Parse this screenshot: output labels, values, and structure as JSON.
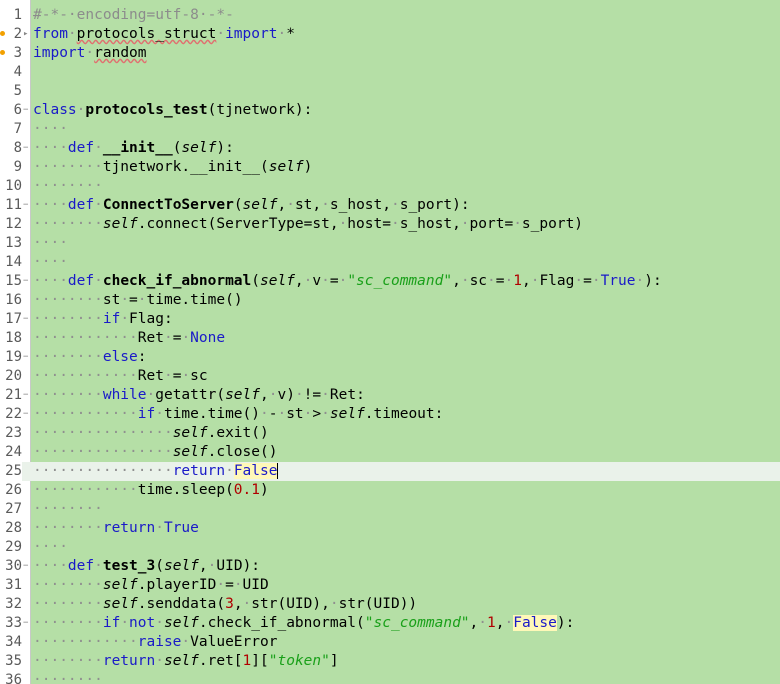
{
  "editor": {
    "language": "python",
    "current_line": 25,
    "colors": {
      "background": "#b5dfa6",
      "current_line": "#eaf2ea",
      "keyword": "#1a1ac8",
      "string": "#1aa01a",
      "number": "#b00000",
      "comment": "#8c8c8c",
      "whitespace_marker": "#8f8f8f"
    },
    "lines": [
      {
        "n": "1",
        "tokens": [
          [
            "cm",
            "#-*-"
          ],
          [
            "cm",
            "·"
          ],
          [
            "cm",
            "encoding=utf-8"
          ],
          [
            "cm",
            "·"
          ],
          [
            "cm",
            "-*-"
          ]
        ]
      },
      {
        "n": "2",
        "mark": true,
        "fold": "▸",
        "tokens": [
          [
            "kw",
            "from"
          ],
          [
            "ws",
            "·"
          ],
          [
            "sq",
            "protocols_struct"
          ],
          [
            "ws",
            "·"
          ],
          [
            "kw",
            "import"
          ],
          [
            "ws",
            "·"
          ],
          [
            "t",
            "*"
          ]
        ]
      },
      {
        "n": "3",
        "mark": true,
        "tokens": [
          [
            "kw",
            "import"
          ],
          [
            "ws",
            "·"
          ],
          [
            "sq",
            "random"
          ]
        ]
      },
      {
        "n": "4",
        "tokens": []
      },
      {
        "n": "5",
        "tokens": []
      },
      {
        "n": "6",
        "fold": "−",
        "tokens": [
          [
            "kw",
            "class"
          ],
          [
            "ws",
            "·"
          ],
          [
            "bd",
            "protocols_test"
          ],
          [
            "t",
            "(tjnetwork):"
          ]
        ]
      },
      {
        "n": "7",
        "tokens": [
          [
            "ws",
            "····"
          ]
        ]
      },
      {
        "n": "8",
        "fold": "−",
        "tokens": [
          [
            "ws",
            "····"
          ],
          [
            "kw",
            "def"
          ],
          [
            "ws",
            "·"
          ],
          [
            "bd",
            "__init__"
          ],
          [
            "t",
            "("
          ],
          [
            "sf",
            "self"
          ],
          [
            "t",
            "):"
          ]
        ]
      },
      {
        "n": "9",
        "tokens": [
          [
            "ws",
            "········"
          ],
          [
            "t",
            "tjnetwork.__init__("
          ],
          [
            "sf",
            "self"
          ],
          [
            "t",
            ")"
          ]
        ]
      },
      {
        "n": "10",
        "tokens": [
          [
            "ws",
            "········"
          ]
        ]
      },
      {
        "n": "11",
        "fold": "−",
        "tokens": [
          [
            "ws",
            "····"
          ],
          [
            "kw",
            "def"
          ],
          [
            "ws",
            "·"
          ],
          [
            "bd",
            "ConnectToServer"
          ],
          [
            "t",
            "("
          ],
          [
            "sf",
            "self"
          ],
          [
            "t",
            ","
          ],
          [
            "ws",
            "·"
          ],
          [
            "t",
            "st,"
          ],
          [
            "ws",
            "·"
          ],
          [
            "t",
            "s_host,"
          ],
          [
            "ws",
            "·"
          ],
          [
            "t",
            "s_port):"
          ]
        ]
      },
      {
        "n": "12",
        "tokens": [
          [
            "ws",
            "········"
          ],
          [
            "sf",
            "self"
          ],
          [
            "t",
            ".connect(ServerType=st,"
          ],
          [
            "ws",
            "·"
          ],
          [
            "t",
            "host="
          ],
          [
            "ws",
            "·"
          ],
          [
            "t",
            "s_host,"
          ],
          [
            "ws",
            "·"
          ],
          [
            "t",
            "port="
          ],
          [
            "ws",
            "·"
          ],
          [
            "t",
            "s_port)"
          ]
        ]
      },
      {
        "n": "13",
        "tokens": [
          [
            "ws",
            "····"
          ]
        ]
      },
      {
        "n": "14",
        "tokens": [
          [
            "ws",
            "····"
          ]
        ]
      },
      {
        "n": "15",
        "fold": "−",
        "tokens": [
          [
            "ws",
            "····"
          ],
          [
            "kw",
            "def"
          ],
          [
            "ws",
            "·"
          ],
          [
            "bd",
            "check_if_abnormal"
          ],
          [
            "t",
            "("
          ],
          [
            "sf",
            "self"
          ],
          [
            "t",
            ","
          ],
          [
            "ws",
            "·"
          ],
          [
            "t",
            "v"
          ],
          [
            "ws",
            "·"
          ],
          [
            "t",
            "="
          ],
          [
            "ws",
            "·"
          ],
          [
            "st",
            "\"sc_command\""
          ],
          [
            "t",
            ","
          ],
          [
            "ws",
            "·"
          ],
          [
            "t",
            "sc"
          ],
          [
            "ws",
            "·"
          ],
          [
            "t",
            "="
          ],
          [
            "ws",
            "·"
          ],
          [
            "nm",
            "1"
          ],
          [
            "t",
            ","
          ],
          [
            "ws",
            "·"
          ],
          [
            "t",
            "Flag"
          ],
          [
            "ws",
            "·"
          ],
          [
            "t",
            "="
          ],
          [
            "ws",
            "·"
          ],
          [
            "bi",
            "True"
          ],
          [
            "ws",
            "·"
          ],
          [
            "t",
            "):"
          ]
        ]
      },
      {
        "n": "16",
        "tokens": [
          [
            "ws",
            "········"
          ],
          [
            "t",
            "st"
          ],
          [
            "ws",
            "·"
          ],
          [
            "t",
            "="
          ],
          [
            "ws",
            "·"
          ],
          [
            "t",
            "time.time()"
          ]
        ]
      },
      {
        "n": "17",
        "fold": "−",
        "tokens": [
          [
            "ws",
            "········"
          ],
          [
            "kw",
            "if"
          ],
          [
            "ws",
            "·"
          ],
          [
            "t",
            "Flag:"
          ]
        ]
      },
      {
        "n": "18",
        "tokens": [
          [
            "ws",
            "············"
          ],
          [
            "t",
            "Ret"
          ],
          [
            "ws",
            "·"
          ],
          [
            "t",
            "="
          ],
          [
            "ws",
            "·"
          ],
          [
            "bi",
            "None"
          ]
        ]
      },
      {
        "n": "19",
        "fold": "−",
        "tokens": [
          [
            "ws",
            "········"
          ],
          [
            "kw",
            "else"
          ],
          [
            "t",
            ":"
          ]
        ]
      },
      {
        "n": "20",
        "tokens": [
          [
            "ws",
            "············"
          ],
          [
            "t",
            "Ret"
          ],
          [
            "ws",
            "·"
          ],
          [
            "t",
            "="
          ],
          [
            "ws",
            "·"
          ],
          [
            "t",
            "sc"
          ]
        ]
      },
      {
        "n": "21",
        "fold": "−",
        "tokens": [
          [
            "ws",
            "········"
          ],
          [
            "kw",
            "while"
          ],
          [
            "ws",
            "·"
          ],
          [
            "t",
            "getattr("
          ],
          [
            "sf",
            "self"
          ],
          [
            "t",
            ","
          ],
          [
            "ws",
            "·"
          ],
          [
            "t",
            "v)"
          ],
          [
            "ws",
            "·"
          ],
          [
            "t",
            "!="
          ],
          [
            "ws",
            "·"
          ],
          [
            "t",
            "Ret:"
          ]
        ]
      },
      {
        "n": "22",
        "fold": "−",
        "tokens": [
          [
            "ws",
            "············"
          ],
          [
            "kw",
            "if"
          ],
          [
            "ws",
            "·"
          ],
          [
            "t",
            "time.time()"
          ],
          [
            "ws",
            "·"
          ],
          [
            "t",
            "-"
          ],
          [
            "ws",
            "·"
          ],
          [
            "t",
            "st"
          ],
          [
            "ws",
            "·"
          ],
          [
            "t",
            ">"
          ],
          [
            "ws",
            "·"
          ],
          [
            "sf",
            "self"
          ],
          [
            "t",
            ".timeout:"
          ]
        ]
      },
      {
        "n": "23",
        "tokens": [
          [
            "ws",
            "················"
          ],
          [
            "sf",
            "self"
          ],
          [
            "t",
            ".exit()"
          ]
        ]
      },
      {
        "n": "24",
        "tokens": [
          [
            "ws",
            "················"
          ],
          [
            "sf",
            "self"
          ],
          [
            "t",
            ".close()"
          ]
        ]
      },
      {
        "n": "25",
        "current": true,
        "tokens": [
          [
            "ws",
            "················"
          ],
          [
            "kw",
            "return"
          ],
          [
            "ws",
            "·"
          ],
          [
            "bih",
            "False"
          ]
        ]
      },
      {
        "n": "26",
        "tokens": [
          [
            "ws",
            "············"
          ],
          [
            "t",
            "time.sleep("
          ],
          [
            "nm",
            "0.1"
          ],
          [
            "t",
            ")"
          ]
        ]
      },
      {
        "n": "27",
        "tokens": [
          [
            "ws",
            "········"
          ]
        ]
      },
      {
        "n": "28",
        "tokens": [
          [
            "ws",
            "········"
          ],
          [
            "kw",
            "return"
          ],
          [
            "ws",
            "·"
          ],
          [
            "bi",
            "True"
          ]
        ]
      },
      {
        "n": "29",
        "tokens": [
          [
            "ws",
            "····"
          ]
        ]
      },
      {
        "n": "30",
        "fold": "−",
        "tokens": [
          [
            "ws",
            "····"
          ],
          [
            "kw",
            "def"
          ],
          [
            "ws",
            "·"
          ],
          [
            "bd",
            "test_3"
          ],
          [
            "t",
            "("
          ],
          [
            "sf",
            "self"
          ],
          [
            "t",
            ","
          ],
          [
            "ws",
            "·"
          ],
          [
            "t",
            "UID):"
          ]
        ]
      },
      {
        "n": "31",
        "tokens": [
          [
            "ws",
            "········"
          ],
          [
            "sf",
            "self"
          ],
          [
            "t",
            ".playerID"
          ],
          [
            "ws",
            "·"
          ],
          [
            "t",
            "="
          ],
          [
            "ws",
            "·"
          ],
          [
            "t",
            "UID"
          ]
        ]
      },
      {
        "n": "32",
        "tokens": [
          [
            "ws",
            "········"
          ],
          [
            "sf",
            "self"
          ],
          [
            "t",
            ".senddata("
          ],
          [
            "nm",
            "3"
          ],
          [
            "t",
            ","
          ],
          [
            "ws",
            "·"
          ],
          [
            "t",
            "str(UID),"
          ],
          [
            "ws",
            "·"
          ],
          [
            "t",
            "str(UID))"
          ]
        ]
      },
      {
        "n": "33",
        "fold": "−",
        "tokens": [
          [
            "ws",
            "········"
          ],
          [
            "kw",
            "if"
          ],
          [
            "ws",
            "·"
          ],
          [
            "kw",
            "not"
          ],
          [
            "ws",
            "·"
          ],
          [
            "sf",
            "self"
          ],
          [
            "t",
            ".check_if_abnormal("
          ],
          [
            "st",
            "\"sc_command\""
          ],
          [
            "t",
            ","
          ],
          [
            "ws",
            "·"
          ],
          [
            "nm",
            "1"
          ],
          [
            "t",
            ","
          ],
          [
            "ws",
            "·"
          ],
          [
            "bih",
            "False"
          ],
          [
            "t",
            "):"
          ]
        ]
      },
      {
        "n": "34",
        "tokens": [
          [
            "ws",
            "············"
          ],
          [
            "kw",
            "raise"
          ],
          [
            "ws",
            "·"
          ],
          [
            "t",
            "ValueError"
          ]
        ]
      },
      {
        "n": "35",
        "tokens": [
          [
            "ws",
            "········"
          ],
          [
            "kw",
            "return"
          ],
          [
            "ws",
            "·"
          ],
          [
            "sf",
            "self"
          ],
          [
            "t",
            ".ret["
          ],
          [
            "nm",
            "1"
          ],
          [
            "t",
            "]["
          ],
          [
            "st",
            "\"token\""
          ],
          [
            "t",
            "]"
          ]
        ]
      },
      {
        "n": "36",
        "tokens": [
          [
            "ws",
            "········"
          ]
        ]
      }
    ]
  }
}
